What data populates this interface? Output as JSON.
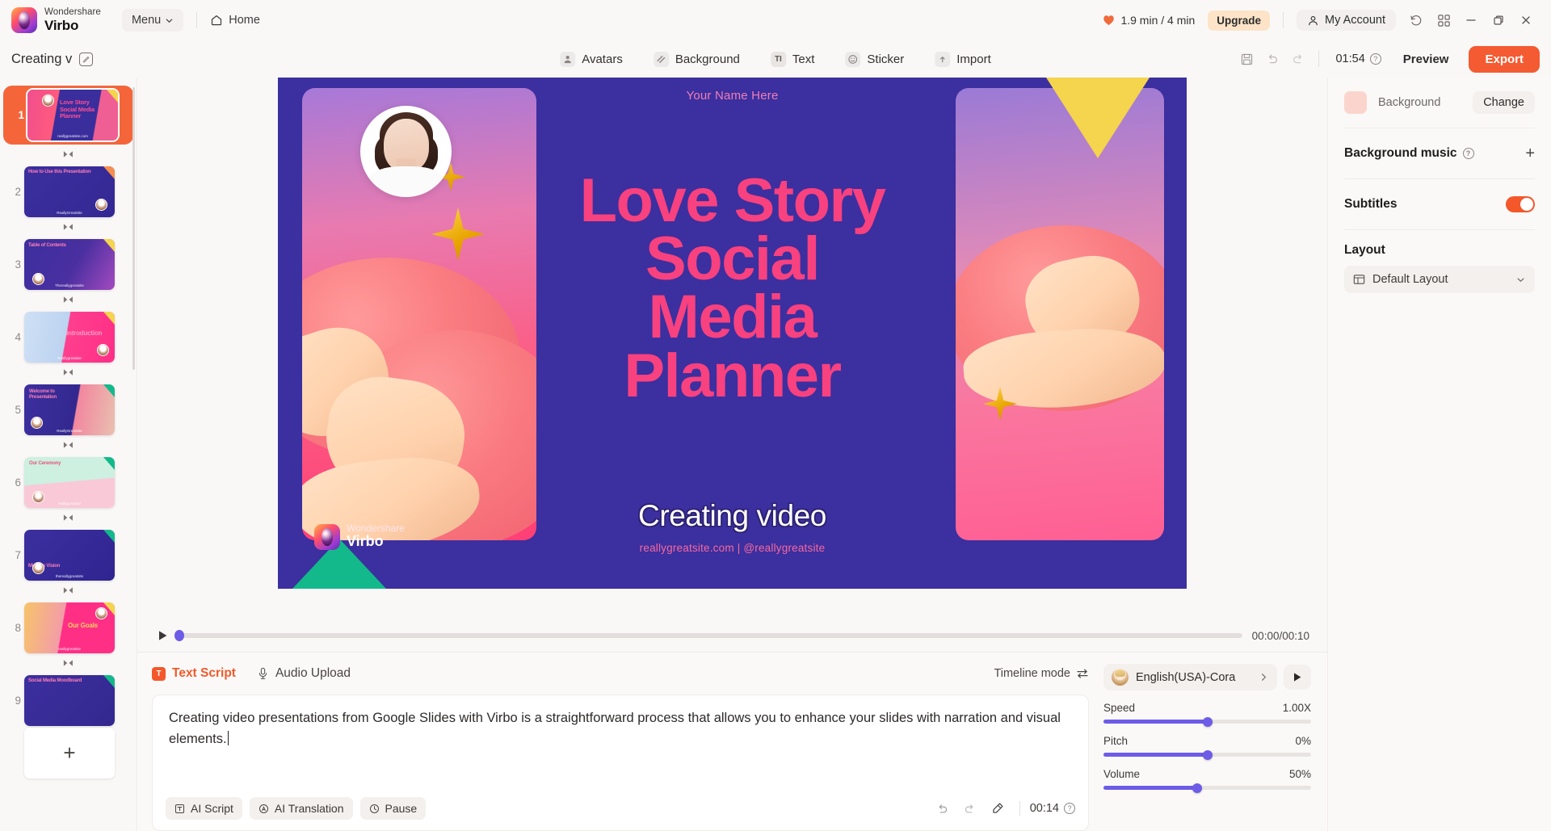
{
  "titlebar": {
    "brand_top": "Wondershare",
    "brand_bottom": "Virbo",
    "menu_label": "Menu",
    "home_label": "Home",
    "credits": "1.9 min / 4 min",
    "upgrade_label": "Upgrade",
    "account_label": "My Account",
    "icons": [
      "heart-icon",
      "history-icon",
      "apps-grid-icon",
      "minimize-icon",
      "restore-icon",
      "close-icon"
    ]
  },
  "subbar": {
    "project_name": "Creating v",
    "tools": [
      {
        "label": "Avatars",
        "icon": "avatar-icon"
      },
      {
        "label": "Background",
        "icon": "background-icon"
      },
      {
        "label": "Text",
        "icon": "text-icon",
        "glyph": "TI"
      },
      {
        "label": "Sticker",
        "icon": "sticker-icon"
      },
      {
        "label": "Import",
        "icon": "import-icon"
      }
    ],
    "duration": "01:54",
    "preview_label": "Preview",
    "export_label": "Export"
  },
  "rail": {
    "slides": [
      {
        "num": "1",
        "title": "Love Story Social Media Planner",
        "caption": "reallygreatsite.com",
        "active": true
      },
      {
        "num": "2",
        "title": "How to Use this Presentation",
        "caption": "ReallyGreatSite",
        "active": false
      },
      {
        "num": "3",
        "title": "Table of Contents",
        "caption": "Thereallygreatsite",
        "active": false
      },
      {
        "num": "4",
        "title": "Introduction",
        "caption": "Reallygreatsite",
        "active": false
      },
      {
        "num": "5",
        "title": "Welcome to Presentation",
        "caption": "ReallyGreatSite",
        "active": false
      },
      {
        "num": "6",
        "title": "Our Ceremony",
        "caption": "reallygreatsite",
        "active": false
      },
      {
        "num": "7",
        "title": "Mission Vision",
        "caption": "thereallygreatsite",
        "active": false
      },
      {
        "num": "8",
        "title": "Our Goals",
        "caption": "reallygreatsite",
        "active": false
      },
      {
        "num": "9",
        "title": "Social Media Moodboard",
        "caption": "",
        "active": false
      }
    ],
    "add_slide_label": "+"
  },
  "canvas": {
    "your_name": "Your Name Here",
    "title_lines": [
      "Love Story",
      "Social",
      "Media",
      "Planner"
    ],
    "subtitle": "Creating video",
    "url_line": "reallygreatsite.com  |  @reallygreatsite",
    "watermark_top": "Wondershare",
    "watermark_bottom": "Virbo"
  },
  "playback": {
    "current_time": "00:00",
    "total_time": "00:10",
    "timecode": "00:00/00:10",
    "progress_percent": 0
  },
  "script_panel": {
    "tabs": [
      {
        "label": "Text Script",
        "active": true,
        "icon": "text-script-icon"
      },
      {
        "label": "Audio Upload",
        "active": false,
        "icon": "microphone-icon"
      }
    ],
    "timeline_mode_label": "Timeline mode",
    "script_text": "Creating video presentations from Google Slides with Virbo is a straightforward process that allows you to enhance your slides with narration and visual elements.",
    "buttons": [
      {
        "label": "AI Script",
        "icon": "ai-script-icon"
      },
      {
        "label": "AI Translation",
        "icon": "ai-translation-icon"
      },
      {
        "label": "Pause",
        "icon": "pause-clock-icon"
      }
    ],
    "script_duration": "00:14"
  },
  "voice_panel": {
    "voice_name": "English(USA)-Cora",
    "sliders": [
      {
        "label": "Speed",
        "value": "1.00X",
        "percent": 50
      },
      {
        "label": "Pitch",
        "value": "0%",
        "percent": 50
      },
      {
        "label": "Volume",
        "value": "50%",
        "percent": 45
      }
    ]
  },
  "rightbar": {
    "background_label": "Background",
    "change_label": "Change",
    "background_music_label": "Background music",
    "subtitles_label": "Subtitles",
    "subtitles_on": true,
    "layout_label": "Layout",
    "layout_value": "Default Layout"
  },
  "colors": {
    "accent": "#f45b32",
    "upgrade_bg": "#fde4c8",
    "slider": "#6c5ce7",
    "canvas_bg": "#3c2f9f",
    "title_pink": "#f8417f"
  }
}
